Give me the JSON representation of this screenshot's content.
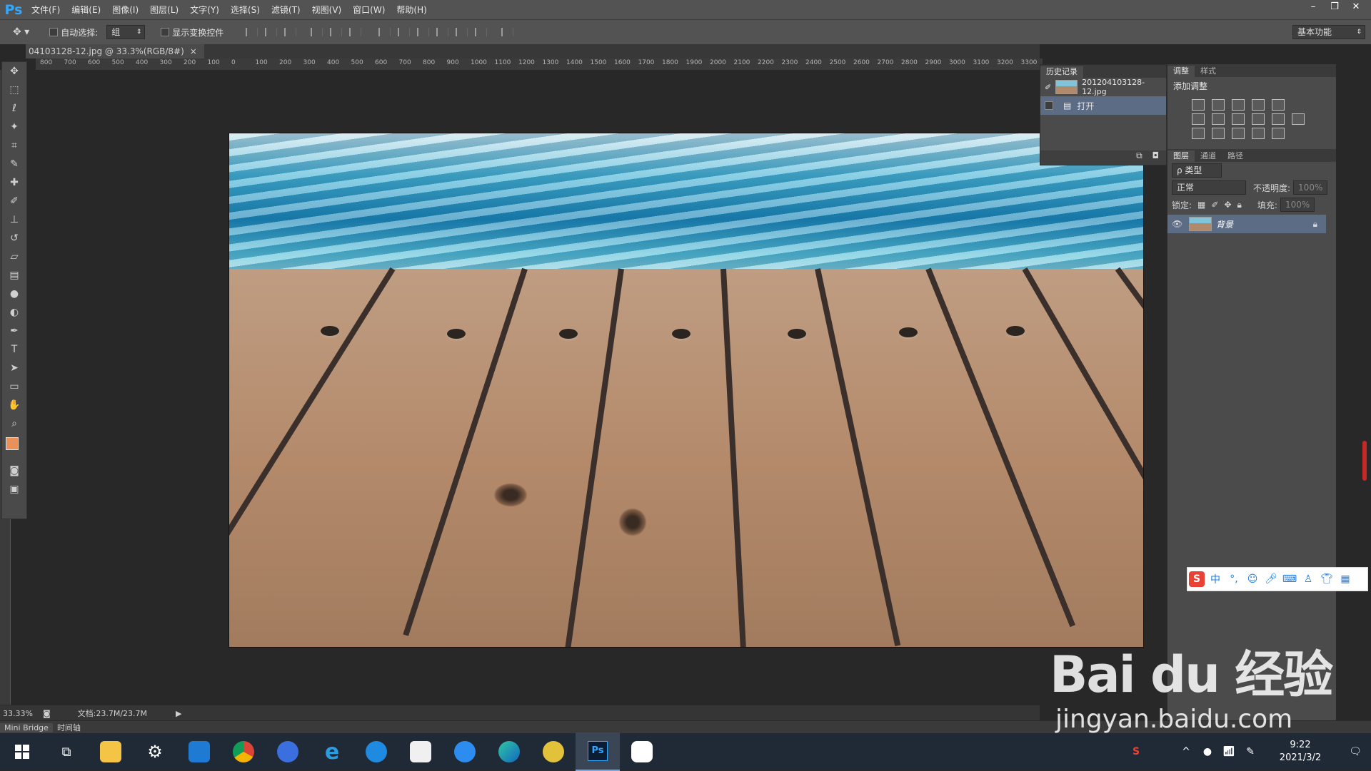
{
  "app": {
    "logo": "Ps",
    "menu": [
      "文件(F)",
      "编辑(E)",
      "图像(I)",
      "图层(L)",
      "文字(Y)",
      "选择(S)",
      "滤镜(T)",
      "视图(V)",
      "窗口(W)",
      "帮助(H)"
    ],
    "window_controls": [
      "–",
      "❐",
      "✕"
    ]
  },
  "options_bar": {
    "auto_select_label": "自动选择:",
    "auto_select_value": "组",
    "show_transform_label": "显示变换控件",
    "workspace": "基本功能"
  },
  "document": {
    "tab_title": "04103128-12.jpg @ 33.3%(RGB/8#)",
    "tab_close": "×",
    "ruler_ticks": [
      "800",
      "700",
      "600",
      "500",
      "400",
      "300",
      "200",
      "100",
      "0",
      "100",
      "200",
      "300",
      "400",
      "500",
      "600",
      "700",
      "800",
      "900",
      "1000",
      "1100",
      "1200",
      "1300",
      "1400",
      "1500",
      "1600",
      "1700",
      "1800",
      "1900",
      "2000",
      "2100",
      "2200",
      "2300",
      "2400",
      "2500",
      "2600",
      "2700",
      "2800",
      "2900",
      "3000",
      "3100",
      "3200",
      "3300"
    ]
  },
  "history_panel": {
    "tab": "历史记录",
    "snapshot": "201204103128-12.jpg",
    "step": "打开"
  },
  "adjust_panel": {
    "tabs": [
      "调整",
      "样式"
    ],
    "title": "添加调整"
  },
  "layers_panel": {
    "tabs": [
      "图层",
      "通道",
      "路径"
    ],
    "filter_label": "ρ 类型",
    "blend_mode": "正常",
    "opacity_label": "不透明度:",
    "opacity_value": "100%",
    "lock_label": "锁定:",
    "fill_label": "填充:",
    "fill_value": "100%",
    "layer_name": "背景"
  },
  "status_bar": {
    "zoom": "33.33%",
    "doc_info": "文档:23.7M/23.7M",
    "bottom_tabs": [
      "Mini Bridge",
      "时间轴"
    ]
  },
  "ime": {
    "mode": "中",
    "punct": "°,"
  },
  "watermark": {
    "brand": "Bai du 经验",
    "url": "jingyan.baidu.com"
  },
  "taskbar": {
    "time": "9:22",
    "date": "2021/3/2",
    "ps_label": "Ps"
  }
}
